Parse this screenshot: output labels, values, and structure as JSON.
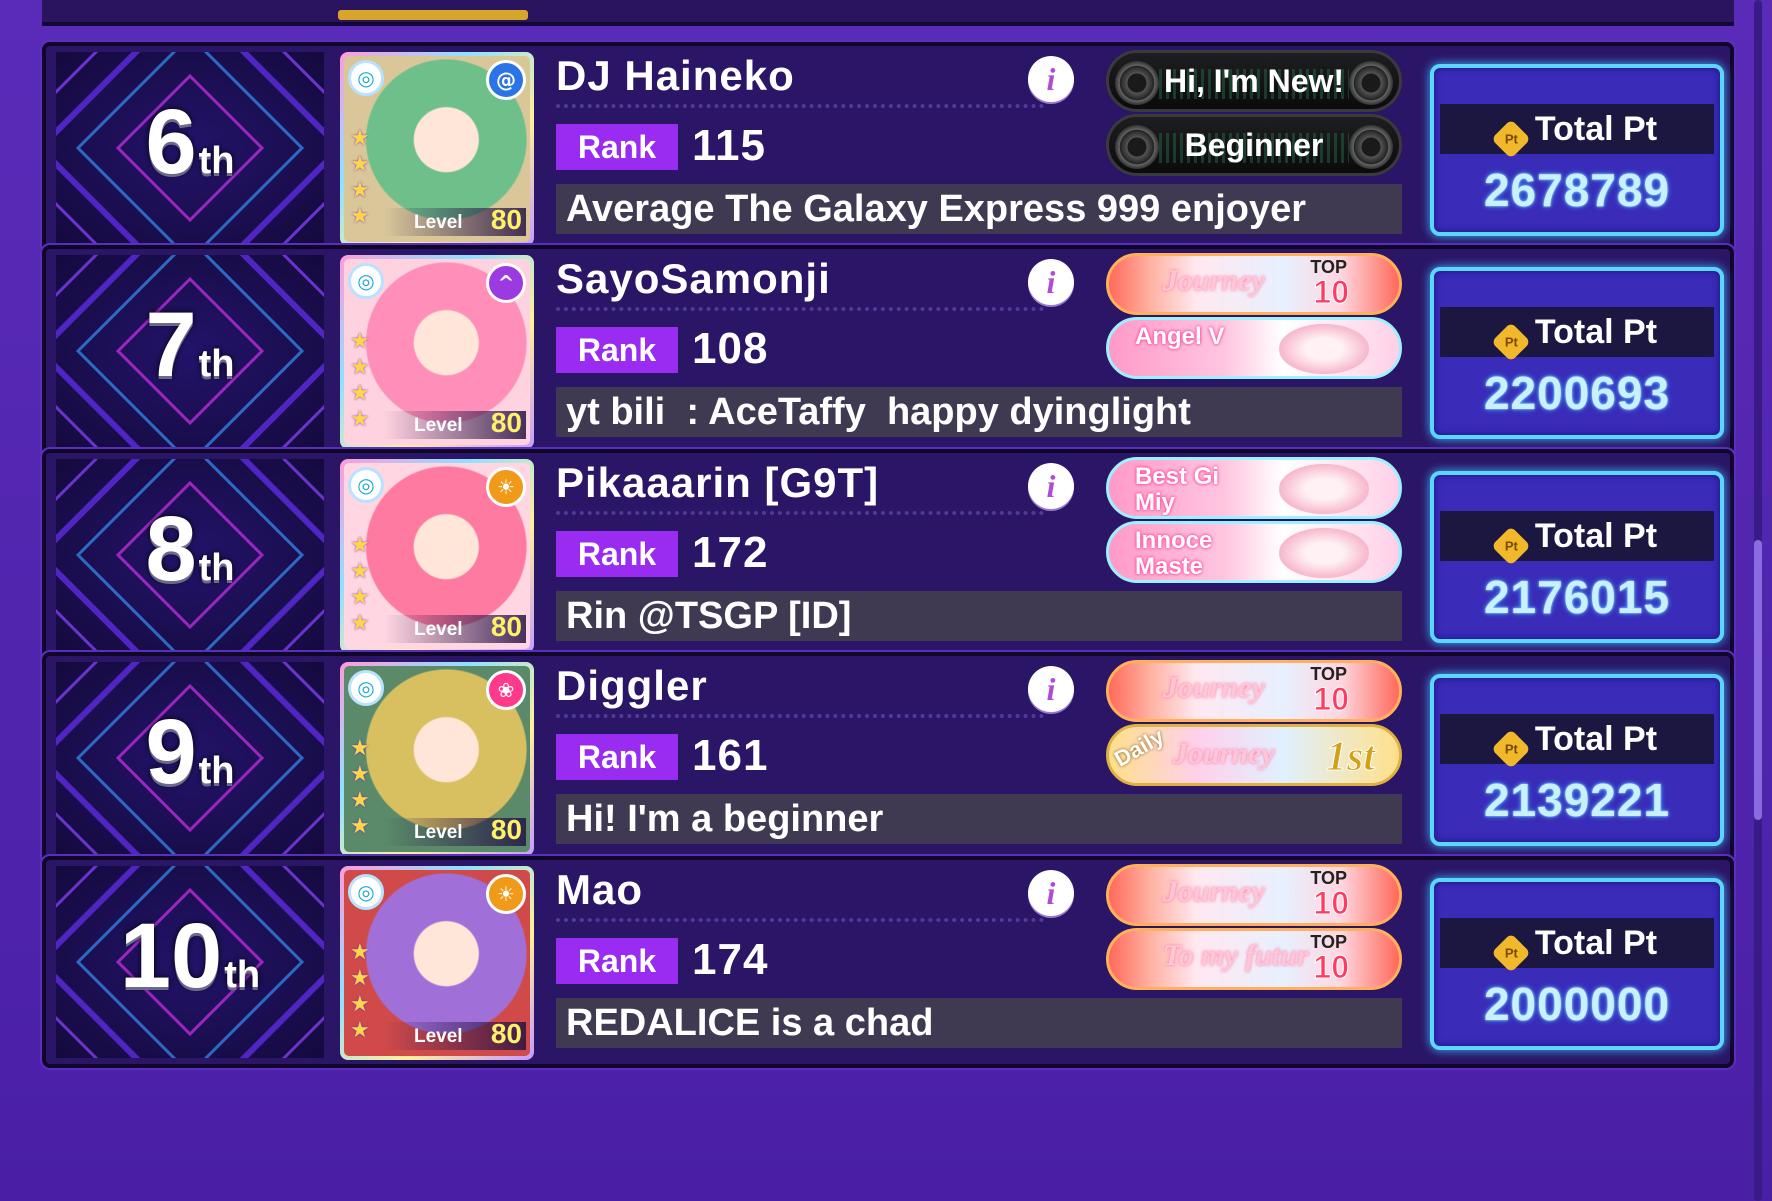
{
  "total_pt_label": "Total Pt",
  "pt_icon_text": "Pt",
  "rank_label": "Rank",
  "level_label": "Level",
  "rows": [
    {
      "placement": "6",
      "suffix": "th",
      "name": "DJ Haineko",
      "player_rank": "115",
      "level": "80",
      "comment": "Average The Galaxy Express 999 enjoyer",
      "total_pt": "2678789",
      "card_colors": [
        "#6fbf8a",
        "#d9c79a"
      ],
      "band_color": "#2a74e8",
      "band_icon": "swirl-icon",
      "badges": [
        {
          "type": "new",
          "text": "Hi, I'm New!"
        },
        {
          "type": "new",
          "text": "Beginner"
        }
      ]
    },
    {
      "placement": "7",
      "suffix": "th",
      "name": "SayoSamonji",
      "player_rank": "108",
      "level": "80",
      "comment": "yt bili  : AceTaffy  happy dyinglight",
      "total_pt": "2200693",
      "card_colors": [
        "#ff8fb8",
        "#ffd2e0"
      ],
      "band_color": "#9b3ae0",
      "band_icon": "hat-icon",
      "badges": [
        {
          "type": "top",
          "text": "Journey",
          "top_label": "TOP",
          "top_num": "10"
        },
        {
          "type": "pink",
          "text": "Angel V"
        }
      ]
    },
    {
      "placement": "8",
      "suffix": "th",
      "name": "Pikaaarin [G9T]",
      "player_rank": "172",
      "level": "80",
      "comment": "Rin @TSGP [ID]",
      "total_pt": "2176015",
      "card_colors": [
        "#ff7aa0",
        "#ffd6e2"
      ],
      "band_color": "#f09a1a",
      "band_icon": "sun-icon",
      "badges": [
        {
          "type": "pink",
          "text": "Best Gi\nMiy"
        },
        {
          "type": "pink",
          "text": "Innoce\nMaste"
        }
      ]
    },
    {
      "placement": "9",
      "suffix": "th",
      "name": "Diggler",
      "player_rank": "161",
      "level": "80",
      "comment": "Hi! I'm a beginner",
      "total_pt": "2139221",
      "card_colors": [
        "#d8c060",
        "#5a8a6a"
      ],
      "band_color": "#ff3a8a",
      "band_icon": "ribbon-icon",
      "badges": [
        {
          "type": "top",
          "text": "Journey",
          "top_label": "TOP",
          "top_num": "10"
        },
        {
          "type": "daily",
          "text": "Journey",
          "daily": "Daily",
          "first": "1st"
        }
      ]
    },
    {
      "placement": "10",
      "suffix": "th",
      "name": "Mao",
      "player_rank": "174",
      "level": "80",
      "comment": "REDALICE is a chad",
      "total_pt": "2000000",
      "card_colors": [
        "#a070d8",
        "#d04a4a"
      ],
      "band_color": "#f09a1a",
      "band_icon": "sun-icon",
      "badges": [
        {
          "type": "top",
          "text": "Journey",
          "top_label": "TOP",
          "top_num": "10"
        },
        {
          "type": "top",
          "text": "To my futur",
          "top_label": "TOP",
          "top_num": "10"
        }
      ]
    }
  ]
}
